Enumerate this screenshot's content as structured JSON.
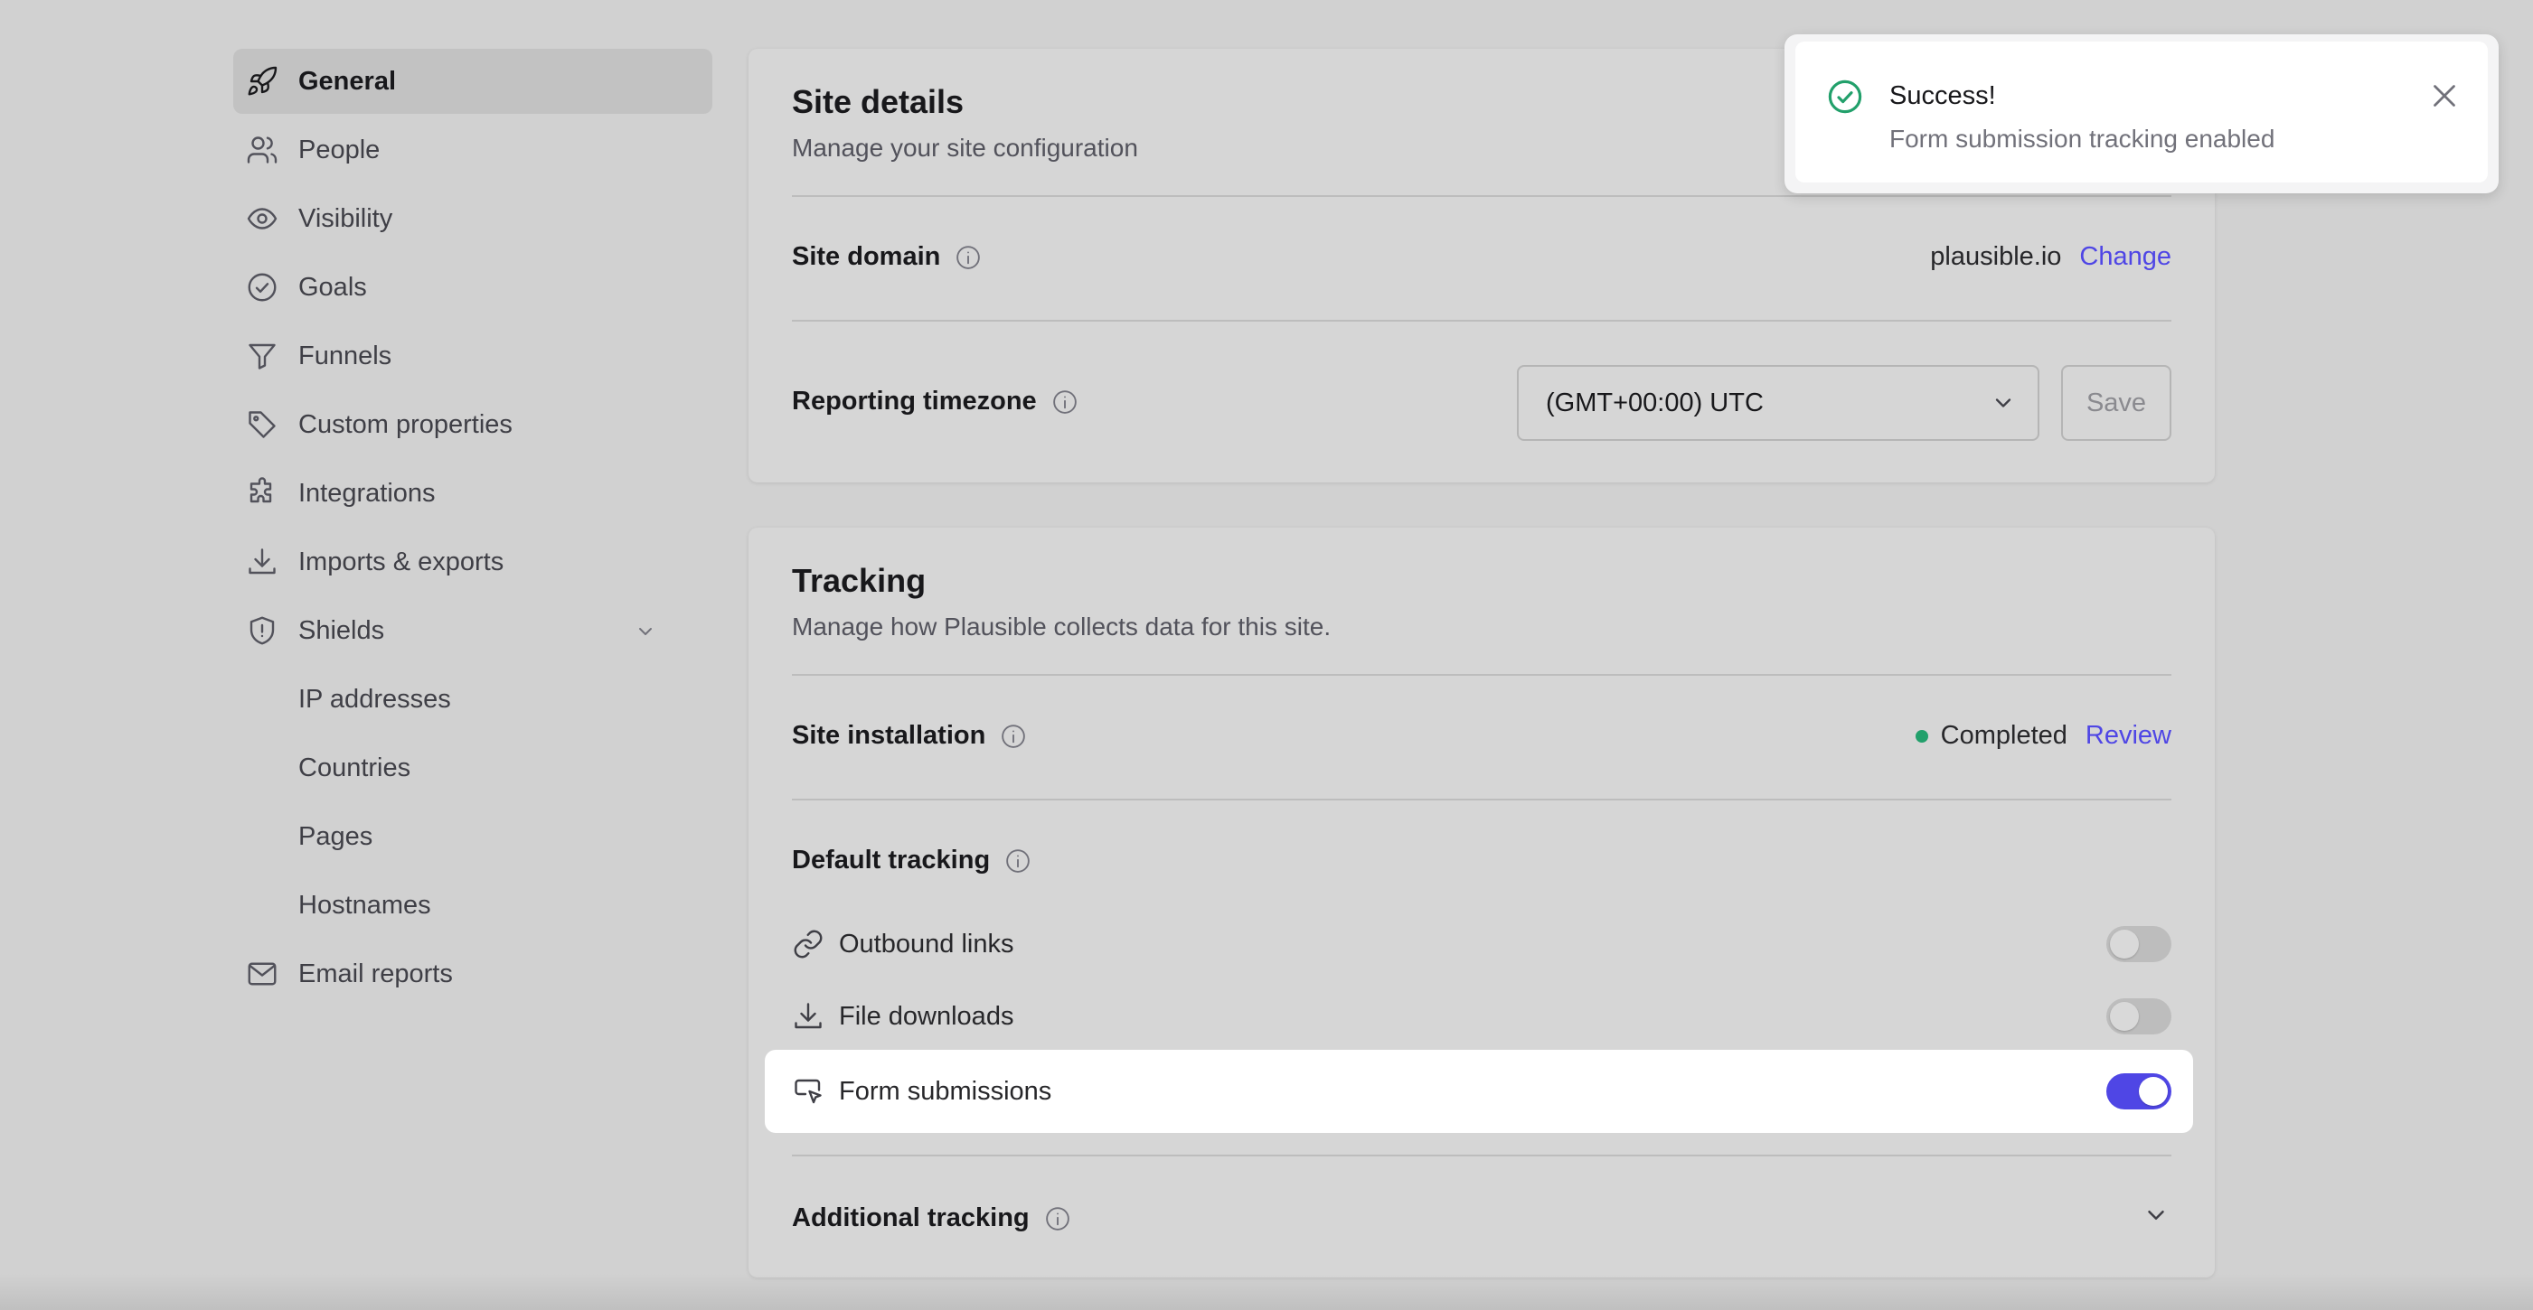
{
  "sidebar": {
    "items": [
      {
        "label": "General",
        "icon": "rocket-icon",
        "active": true
      },
      {
        "label": "People",
        "icon": "people-icon"
      },
      {
        "label": "Visibility",
        "icon": "eye-icon"
      },
      {
        "label": "Goals",
        "icon": "check-circle-icon"
      },
      {
        "label": "Funnels",
        "icon": "funnel-icon"
      },
      {
        "label": "Custom properties",
        "icon": "tag-icon"
      },
      {
        "label": "Integrations",
        "icon": "puzzle-icon"
      },
      {
        "label": "Imports & exports",
        "icon": "download-icon"
      },
      {
        "label": "Shields",
        "icon": "shield-icon",
        "expanded": true
      },
      {
        "label": "IP addresses"
      },
      {
        "label": "Countries"
      },
      {
        "label": "Pages"
      },
      {
        "label": "Hostnames"
      },
      {
        "label": "Email reports",
        "icon": "envelope-icon"
      }
    ]
  },
  "site_details": {
    "title": "Site details",
    "subtitle": "Manage your site configuration",
    "domain_label": "Site domain",
    "domain_value": "plausible.io",
    "domain_change": "Change",
    "timezone_label": "Reporting timezone",
    "timezone_value": "(GMT+00:00) UTC",
    "save_label": "Save"
  },
  "tracking": {
    "title": "Tracking",
    "subtitle": "Manage how Plausible collects data for this site.",
    "installation_label": "Site installation",
    "installation_status": "Completed",
    "installation_review": "Review",
    "default_label": "Default tracking",
    "options": [
      {
        "label": "Outbound links",
        "icon": "link-icon",
        "enabled": false
      },
      {
        "label": "File downloads",
        "icon": "download-icon",
        "enabled": false
      },
      {
        "label": "Form submissions",
        "icon": "form-cursor-icon",
        "enabled": true
      }
    ],
    "additional_label": "Additional tracking"
  },
  "toast": {
    "title": "Success!",
    "message": "Form submission tracking enabled"
  },
  "colors": {
    "accent": "#4f46e5",
    "success": "#22a06b",
    "background": "#d1d1d1"
  }
}
